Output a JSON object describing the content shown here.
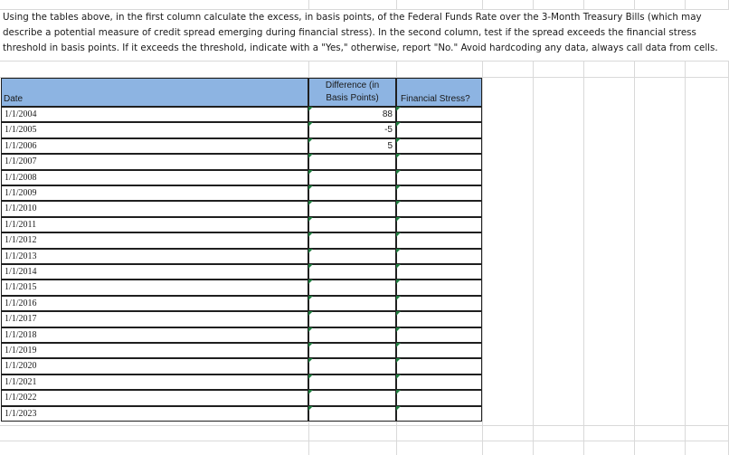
{
  "instructions": {
    "line1": "Using the tables above, in the first column calculate the excess, in basis points, of the Federal Funds Rate over the 3-Month Treasury Bills (which may",
    "line2": "describe a potential measure of credit spread emerging during financial stress).  In the second column, test if the spread exceeds the financial stress",
    "line3": "threshold in basis points.  If it exceeds the threshold, indicate with a \"Yes,\" otherwise, report \"No.\" Avoid hardcoding any data, always call data from cells."
  },
  "table": {
    "headers": {
      "date": "Date",
      "difference_line1": "Difference (in",
      "difference_line2": "Basis Points)",
      "financial_stress": "Financial Stress?"
    },
    "rows": [
      {
        "date": "1/1/2004",
        "difference": "88",
        "stress": ""
      },
      {
        "date": "1/1/2005",
        "difference": "-5",
        "stress": ""
      },
      {
        "date": "1/1/2006",
        "difference": "5",
        "stress": ""
      },
      {
        "date": "1/1/2007",
        "difference": "",
        "stress": ""
      },
      {
        "date": "1/1/2008",
        "difference": "",
        "stress": ""
      },
      {
        "date": "1/1/2009",
        "difference": "",
        "stress": ""
      },
      {
        "date": "1/1/2010",
        "difference": "",
        "stress": ""
      },
      {
        "date": "1/1/2011",
        "difference": "",
        "stress": ""
      },
      {
        "date": "1/1/2012",
        "difference": "",
        "stress": ""
      },
      {
        "date": "1/1/2013",
        "difference": "",
        "stress": ""
      },
      {
        "date": "1/1/2014",
        "difference": "",
        "stress": ""
      },
      {
        "date": "1/1/2015",
        "difference": "",
        "stress": ""
      },
      {
        "date": "1/1/2016",
        "difference": "",
        "stress": ""
      },
      {
        "date": "1/1/2017",
        "difference": "",
        "stress": ""
      },
      {
        "date": "1/1/2018",
        "difference": "",
        "stress": ""
      },
      {
        "date": "1/1/2019",
        "difference": "",
        "stress": ""
      },
      {
        "date": "1/1/2020",
        "difference": "",
        "stress": ""
      },
      {
        "date": "1/1/2021",
        "difference": "",
        "stress": ""
      },
      {
        "date": "1/1/2022",
        "difference": "",
        "stress": ""
      },
      {
        "date": "1/1/2023",
        "difference": "",
        "stress": ""
      }
    ]
  },
  "colors": {
    "header_fill": "#8db4e2",
    "error_marker": "#1f7a3e",
    "gridline": "#d9d9d9"
  }
}
